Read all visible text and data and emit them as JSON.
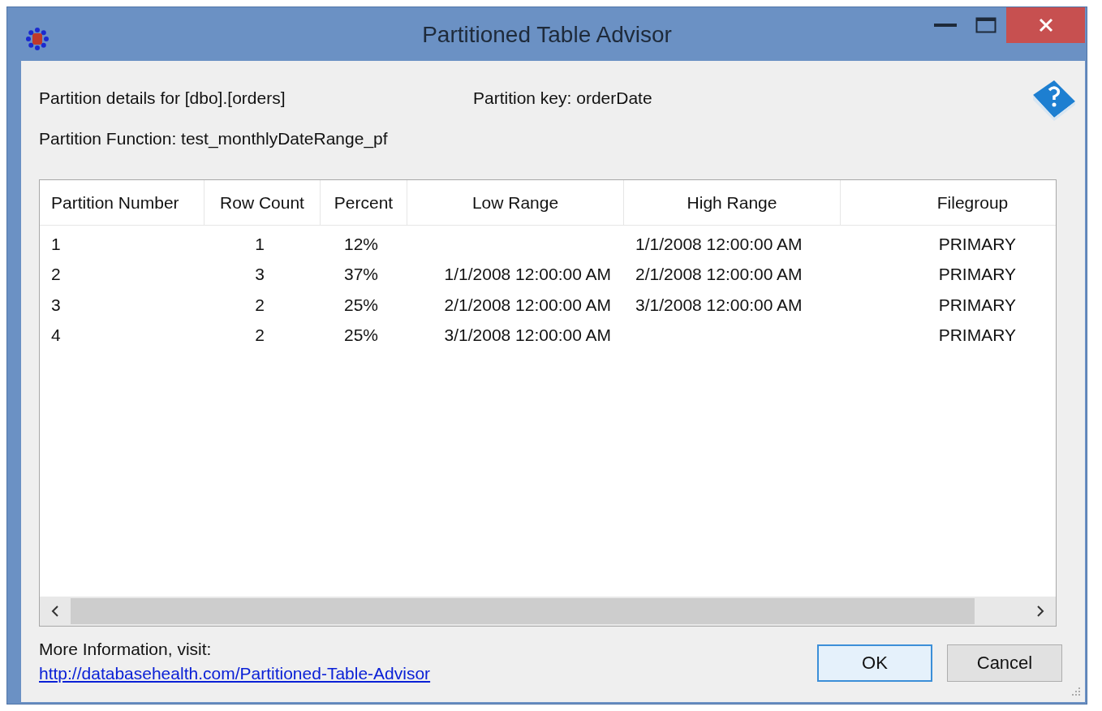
{
  "window": {
    "title": "Partitioned Table Advisor"
  },
  "details": {
    "table": "Partition details for [dbo].[orders]",
    "key": "Partition key: orderDate",
    "function": "Partition Function: test_monthlyDateRange_pf"
  },
  "table": {
    "columns": [
      "Partition Number",
      "Row Count",
      "Percent",
      "Low Range",
      "High Range",
      "Filegroup"
    ],
    "rows": [
      [
        "1",
        "1",
        "12%",
        "",
        "1/1/2008 12:00:00 AM",
        "PRIMARY"
      ],
      [
        "2",
        "3",
        "37%",
        "1/1/2008 12:00:00 AM",
        "2/1/2008 12:00:00 AM",
        "PRIMARY"
      ],
      [
        "3",
        "2",
        "25%",
        "2/1/2008 12:00:00 AM",
        "3/1/2008 12:00:00 AM",
        "PRIMARY"
      ],
      [
        "4",
        "2",
        "25%",
        "3/1/2008 12:00:00 AM",
        "",
        "PRIMARY"
      ]
    ]
  },
  "footer": {
    "text": "More Information, visit:",
    "link": "http://databasehealth.com/Partitioned-Table-Advisor"
  },
  "buttons": [
    {
      "label": "OK",
      "default": true
    },
    {
      "label": "Cancel",
      "default": false
    }
  ]
}
